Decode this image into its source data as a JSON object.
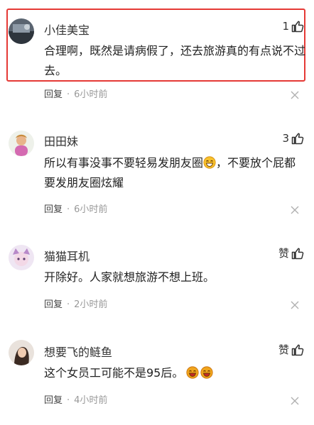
{
  "comments": [
    {
      "author": "小佳美宝",
      "likes": "1",
      "text": "合理啊，既然是请病假了，还去旅游真的有点说不过去。",
      "reply_label": "回复",
      "time": "6小时前",
      "highlighted": true
    },
    {
      "author": "田田妹",
      "likes": "3",
      "text_before_emoji": "所以有事没事不要轻易发朋友圈",
      "text_after_emoji": "，不要放个屁都要发朋友圈炫耀",
      "reply_label": "回复",
      "time": "6小时前"
    },
    {
      "author": "猫猫耳机",
      "likes": "赞",
      "text": "开除好。人家就想旅游不想上班。",
      "reply_label": "回复",
      "time": "2小时前"
    },
    {
      "author": "想要飞的鲢鱼",
      "likes": "赞",
      "text": "这个女员工可能不是95后。",
      "reply_label": "回复",
      "time": "4小时前"
    }
  ],
  "icons": {
    "like": "thumbs-up-icon",
    "close": "close-icon",
    "emoji": "laughing-emoji-icon"
  },
  "colors": {
    "highlight_border": "#e53935",
    "meta_text": "#999999"
  }
}
